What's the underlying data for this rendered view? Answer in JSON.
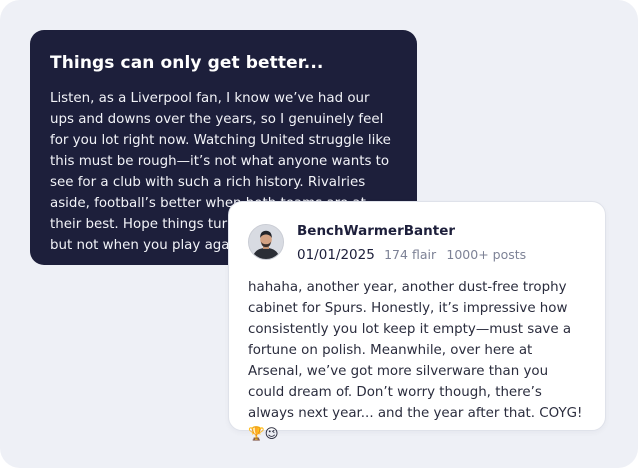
{
  "original_post": {
    "title": "Things can only get better...",
    "body": "Listen, as a Liverpool fan, I know we’ve had our ups and downs over the years, so I genuinely feel for you lot right now. Watching United struggle like this must be rough—it’s not what anyone wants to see for a club with such a rich history. Rivalries aside, football’s better when both teams are at their best. Hope things turn around soon for you, but not when you play against us. 😉 YNWA"
  },
  "reply": {
    "avatar_icon": "user-avatar-photo",
    "username": "BenchWarmerBanter",
    "date": "01/01/2025",
    "flair": "174 flair",
    "posts": "1000+ posts",
    "body": "hahaha, another year, another dust-free trophy cabinet for Spurs. Honestly, it’s impressive how consistently you lot keep it empty—must save a fortune on polish. Meanwhile, over here at Arsenal, we’ve got more silverware than you could dream of. Don’t worry though, there’s always next year... and the year after that. COYG! 🏆😉"
  },
  "colors": {
    "background": "#eef0f6",
    "dark_card": "#1d1f3b",
    "reply_card": "#ffffff",
    "muted_text": "#7d8296"
  }
}
